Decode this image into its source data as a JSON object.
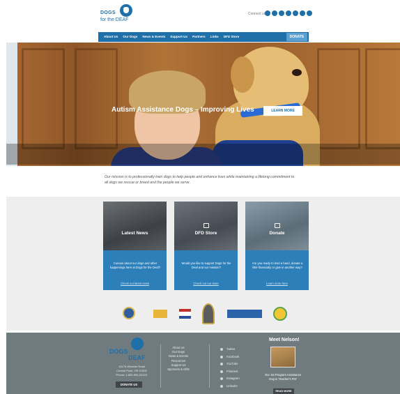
{
  "header": {
    "logo_line1": "DOGS",
    "logo_line2": "for the DEAF",
    "connect_label": "Connect us"
  },
  "nav": {
    "items": [
      "About Us",
      "Our Dogs",
      "News & Events",
      "Support Us",
      "Partners",
      "Links",
      "DFD Store"
    ],
    "donate_label": "DONATE"
  },
  "hero": {
    "title": "Autism Assistance Dogs – Improving Lives",
    "button_label": "LEARN MORE"
  },
  "mission": "Our mission is to professionally train dogs to help people and enhance lives while maintaining a lifelong commitment to all dogs we rescue or breed and the people we serve.",
  "cards": [
    {
      "title": "Latest News",
      "text": "Curious about our dogs and other happenings here at Dogs for the Deaf?",
      "link": "Check out latest news"
    },
    {
      "title": "DFD Store",
      "text": "Would you like to support Dogs for the Deaf and our mission?",
      "link": "Check out our store"
    },
    {
      "title": "Donate",
      "text": "Are you ready to lend a hand, donate a little financially or give in another way?",
      "link": "Learn more here"
    }
  ],
  "footer": {
    "logo_line1": "DOGS",
    "logo_line2": "DEAF",
    "address_line1": "10175 Wheeler Road",
    "address_line2": "Central Point, OR 97502",
    "phone": "Phone: 1-800-990-DOGS",
    "donate_label": "DONATE US",
    "links": [
      "About Us",
      "Our Dogs",
      "News & Events",
      "Resources",
      "Support Us",
      "Sponsors & Gifts"
    ],
    "social": [
      "Twitter",
      "Facebook",
      "YouTube",
      "Pinterest",
      "Instagram",
      "LinkedIn"
    ],
    "meet_title": "Meet Nelson!",
    "meet_text": "Our 1st Program Assistance Dog & 'Teacher's Pet'",
    "read_more": "READ MORE"
  }
}
